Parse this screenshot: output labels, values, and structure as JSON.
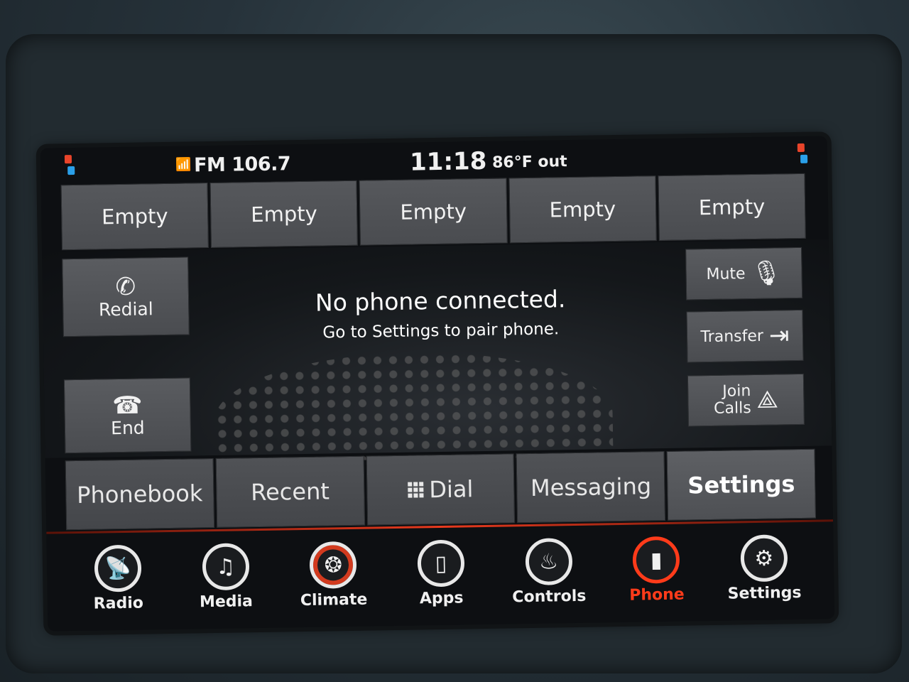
{
  "status_bar": {
    "radio": "FM 106.7",
    "clock": "11:18",
    "temperature": "86°F out"
  },
  "favorites": [
    "Empty",
    "Empty",
    "Empty",
    "Empty",
    "Empty"
  ],
  "call_controls": {
    "redial": "Redial",
    "end": "End",
    "mute": "Mute",
    "transfer": "Transfer",
    "join_calls_line1": "Join",
    "join_calls_line2": "Calls"
  },
  "message": {
    "title": "No phone connected.",
    "subtitle": "Go to Settings to pair phone."
  },
  "phone_tabs": {
    "phonebook": "Phonebook",
    "recent": "Recent",
    "dial": "Dial",
    "messaging": "Messaging",
    "settings": "Settings"
  },
  "bottom_nav": {
    "radio": "Radio",
    "media": "Media",
    "climate": "Climate",
    "apps": "Apps",
    "controls": "Controls",
    "phone": "Phone",
    "settings": "Settings",
    "active": "Phone"
  },
  "colors": {
    "accent": "#ff3b1a",
    "button_bg": "#505256",
    "screen_bg": "#0d0f12"
  },
  "icons": {
    "radio": "radio-tower-icon",
    "media": "music-note-icon",
    "climate": "fan-icon",
    "apps": "apps-icon",
    "controls": "seat-controls-icon",
    "phone": "phone-icon",
    "settings": "gear-icon"
  }
}
